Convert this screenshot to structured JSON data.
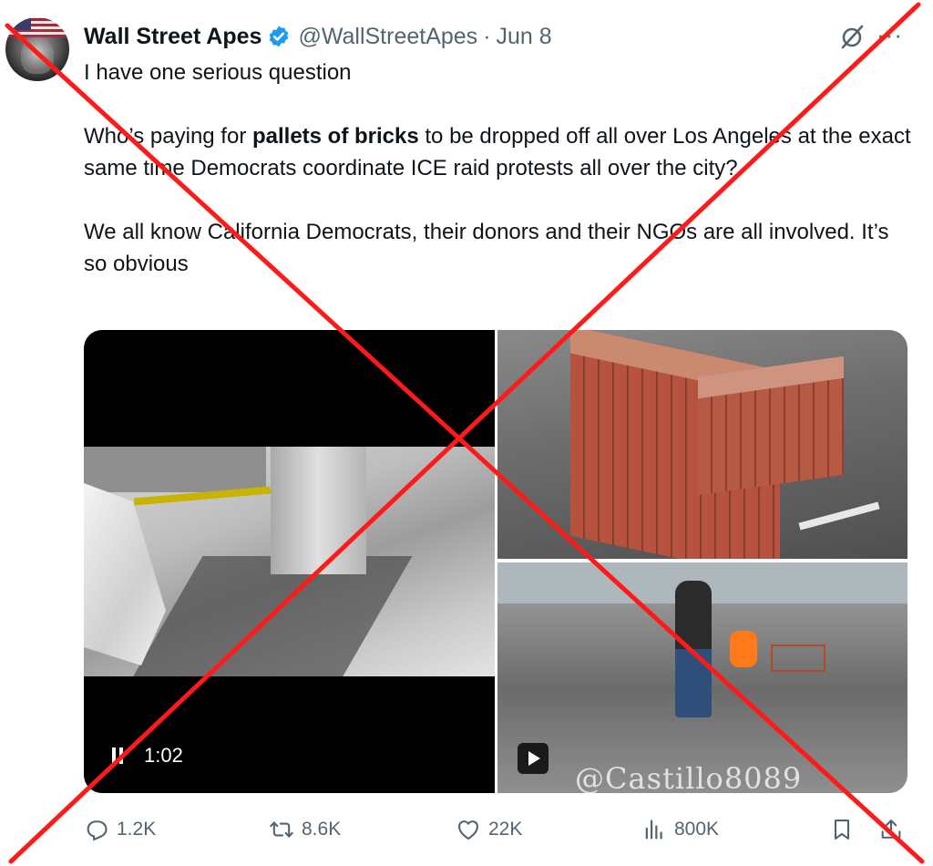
{
  "author": {
    "display_name": "Wall Street Apes",
    "handle": "@WallStreetApes",
    "separator": "·",
    "date": "Jun 8",
    "verified": true
  },
  "tweet": {
    "line1": "I have one serious question",
    "para2_before": "Who’s paying for ",
    "para2_bold": "pallets of bricks",
    "para2_after": " to be dropped off all over Los Angeles at the exact same time Democrats coordinate ICE raid protests all over the city?",
    "para3": "We all know California Democrats, their donors and their NGOs are all involved. It’s so obvious"
  },
  "media": {
    "video_time": "1:02",
    "watermark": "@Castillo8089"
  },
  "actions": {
    "replies": "1.2K",
    "reposts": "8.6K",
    "likes": "22K",
    "views": "800K"
  },
  "icons": [
    "verified-badge-icon",
    "grok-icon",
    "more-icon",
    "pause-icon",
    "play-icon",
    "reply-icon",
    "repost-icon",
    "like-icon",
    "views-icon",
    "bookmark-icon",
    "share-icon"
  ],
  "colors": {
    "verified_blue": "#1d9bf0",
    "text": "#0f1419",
    "secondary": "#536471",
    "cross_out": "#ff1a1a"
  }
}
